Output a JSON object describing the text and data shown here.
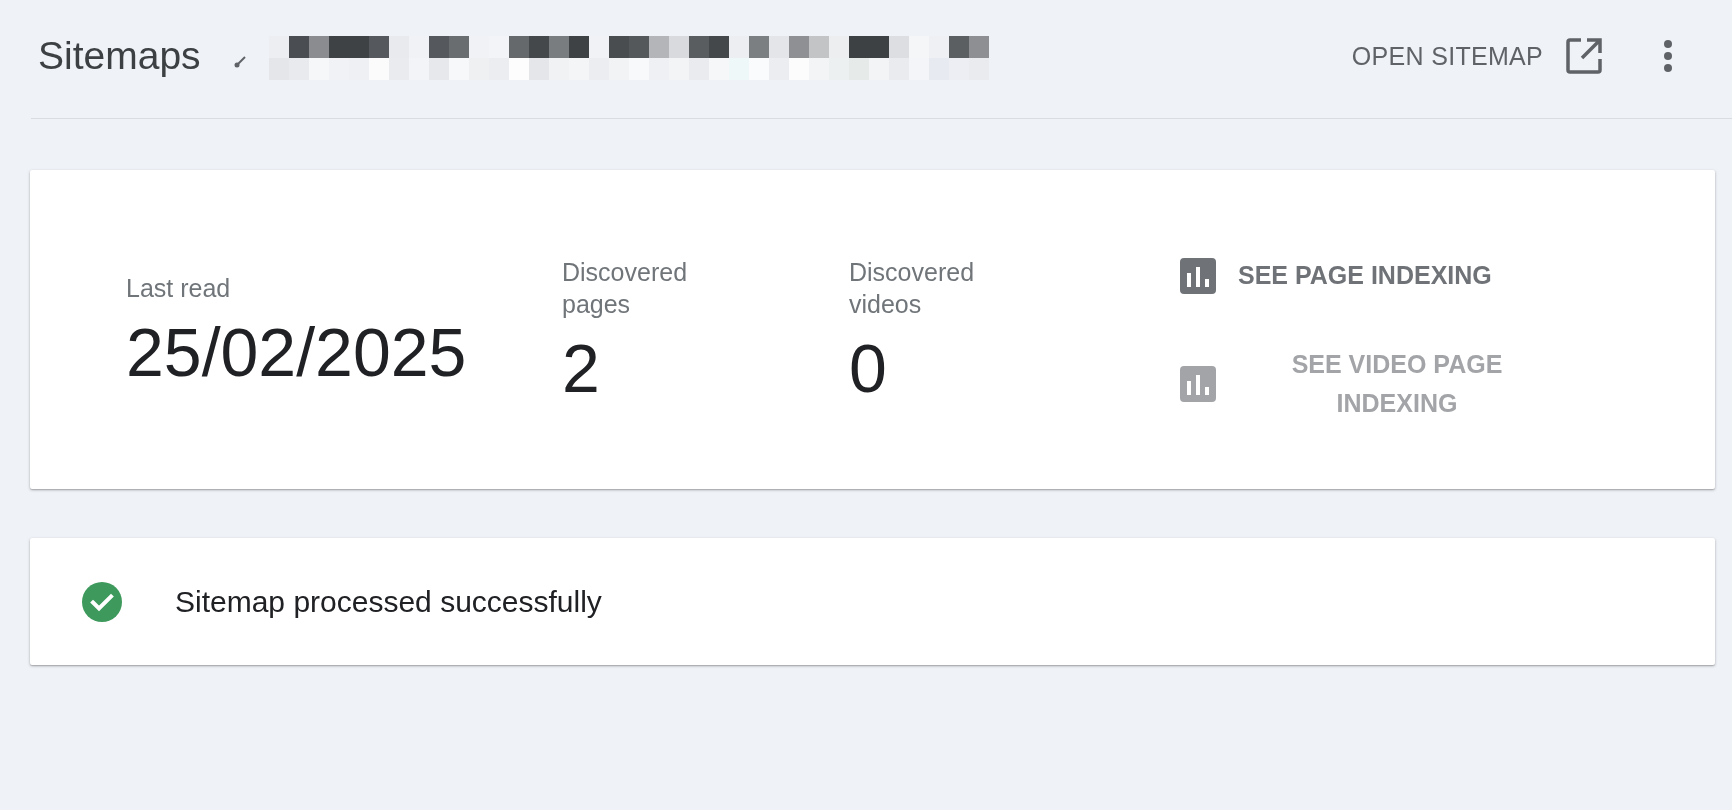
{
  "header": {
    "title": "Sitemaps",
    "url_redacted": true,
    "open_link": {
      "label": "OPEN SITEMAP"
    }
  },
  "summary": {
    "stats": [
      {
        "label": "Last read",
        "value": "25/02/2025"
      },
      {
        "label": "Discovered pages",
        "value": "2"
      },
      {
        "label": "Discovered videos",
        "value": "0"
      }
    ],
    "links": [
      {
        "label": "SEE PAGE INDEXING",
        "disabled": false
      },
      {
        "label": "SEE VIDEO PAGE INDEXING",
        "disabled": true
      }
    ]
  },
  "status": {
    "kind": "success",
    "message": "Sitemap processed successfully"
  }
}
